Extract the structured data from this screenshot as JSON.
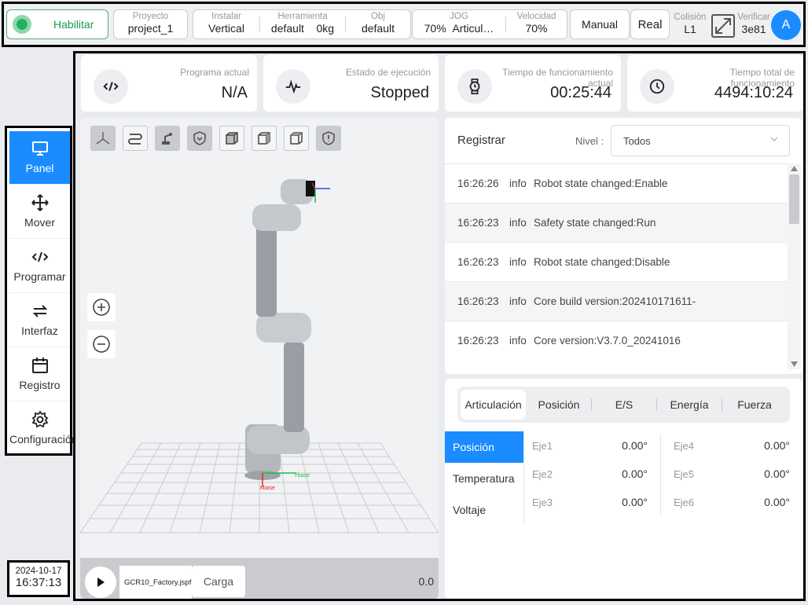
{
  "topbar": {
    "enable_label": "Habilitar",
    "project": {
      "label": "Proyecto",
      "value": "project_1"
    },
    "install": {
      "label": "Instalar",
      "value": "Vertical"
    },
    "tool": {
      "label": "Herramienta",
      "value": "default",
      "mass": "0kg"
    },
    "obj": {
      "label": "Obj",
      "value": "default"
    },
    "jog": {
      "label": "JOG",
      "percent": "70%",
      "mode": "Articul…"
    },
    "speed": {
      "label": "Velocidad",
      "value": "70%"
    },
    "manual_label": "Manual",
    "real_label": "Real",
    "collision": {
      "label": "Colisión",
      "value": "L1"
    },
    "verify": {
      "label": "Verificar",
      "value": "3e81"
    },
    "avatar": "A"
  },
  "sidebar": {
    "items": [
      {
        "label": "Panel",
        "icon": "monitor-icon"
      },
      {
        "label": "Mover",
        "icon": "move-icon"
      },
      {
        "label": "Programar",
        "icon": "code-icon"
      },
      {
        "label": "Interfaz",
        "icon": "swap-icon"
      },
      {
        "label": "Registro",
        "icon": "calendar-icon"
      },
      {
        "label": "Configuración",
        "icon": "gear-icon"
      }
    ]
  },
  "clock": {
    "date": "2024-10-17",
    "time": "16:37:13"
  },
  "stats": {
    "program": {
      "label": "Programa actual",
      "value": "N/A"
    },
    "state": {
      "label": "Estado de ejecución",
      "value": "Stopped"
    },
    "runtime": {
      "label": "Tiempo de funcionamiento actual",
      "value": "00:25:44"
    },
    "total": {
      "label": "Tiempo total de funcionamiento",
      "value": "4494:10:24"
    }
  },
  "viewport": {
    "file_name": "GCR10_Factory.jspf",
    "load_label": "Carga",
    "value": "0.0",
    "axis_x": "Xbase",
    "axis_y": "Ybase"
  },
  "log": {
    "title": "Registrar",
    "level_label": "Nivel :",
    "level_value": "Todos",
    "rows": [
      {
        "time": "16:26:26",
        "level": "info",
        "msg": "Robot state changed:Enable"
      },
      {
        "time": "16:26:23",
        "level": "info",
        "msg": "Safety state changed:Run"
      },
      {
        "time": "16:26:23",
        "level": "info",
        "msg": "Robot state changed:Disable"
      },
      {
        "time": "16:26:23",
        "level": "info",
        "msg": "Core build version:202410171611-"
      },
      {
        "time": "16:26:23",
        "level": "info",
        "msg": "Core version:V3.7.0_20241016"
      }
    ]
  },
  "joints": {
    "tabs": [
      "Articulación",
      "Posición",
      "E/S",
      "Energía",
      "Fuerza"
    ],
    "subnav": [
      "Posición",
      "Temperatura",
      "Voltaje"
    ],
    "values": [
      {
        "name": "Eje1",
        "value": "0.00°"
      },
      {
        "name": "Eje2",
        "value": "0.00°"
      },
      {
        "name": "Eje3",
        "value": "0.00°"
      },
      {
        "name": "Eje4",
        "value": "0.00°"
      },
      {
        "name": "Eje5",
        "value": "0.00°"
      },
      {
        "name": "Eje6",
        "value": "0.00°"
      }
    ]
  }
}
